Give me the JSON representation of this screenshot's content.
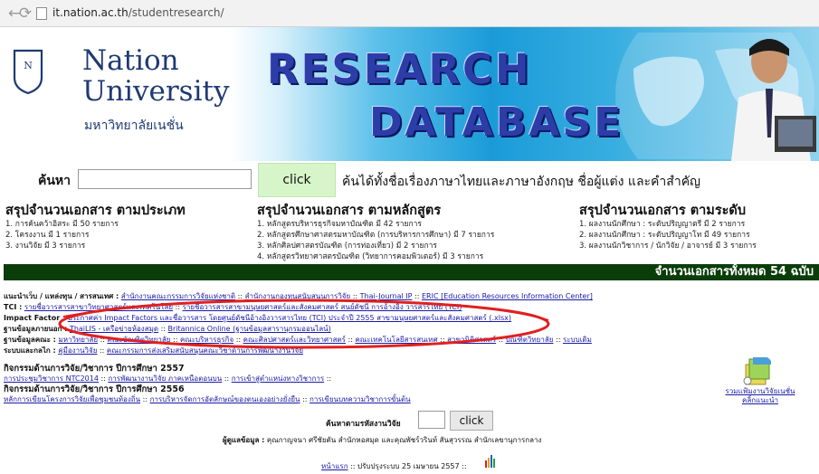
{
  "browser": {
    "url_host": "it.nation.ac.th",
    "url_path": "/studentresearch/"
  },
  "banner": {
    "logo_line1": "Nation",
    "logo_line2": "University",
    "logo_thai": "มหาวิทยาลัยเนชั่น",
    "title_line1": "RESEARCH",
    "title_line2": "DATABASE"
  },
  "search": {
    "label": "ค้นหา",
    "input_value": "",
    "button_label": "click",
    "hint": "ค้นได้ทั้งชื่อเรื่องภาษาไทยและภาษาอังกฤษ ชื่อผู้แต่ง และคำสำคัญ"
  },
  "summary": {
    "by_type": {
      "heading": "สรุปจำนวนเอกสาร ตามประเภท",
      "items": [
        "1. การค้นคว้าอิสระ มี 50 รายการ",
        "2. โครงงาน มี 1 รายการ",
        "3. งานวิจัย มี 3 รายการ"
      ]
    },
    "by_program": {
      "heading": "สรุปจำนวนเอกสาร ตามหลักสูตร",
      "items": [
        "1. หลักสูตรบริหารธุรกิจมหาบัณฑิต มี 42 รายการ",
        "2. หลักสูตรศึกษาศาสตรมหาบัณฑิต (การบริหารการศึกษา) มี 7 รายการ",
        "3. หลักศิลปศาสตรบัณฑิต (การท่องเที่ยว) มี 2 รายการ",
        "4. หลักสูตรวิทยาศาสตรบัณฑิต (วิทยาการคอมพิวเตอร์) มี 3 รายการ"
      ]
    },
    "by_level": {
      "heading": "สรุปจำนวนเอกสาร ตามระดับ",
      "items": [
        "1. ผลงานนักศึกษา : ระดับปริญญาตรี มี 2 รายการ",
        "2. ผลงานนักศึกษา : ระดับปริญญาโท มี 49 รายการ",
        "3. ผลงานนักวิชาการ / นักวิจัย / อาจารย์ มี 3 รายการ"
      ]
    }
  },
  "total_text": "จำนวนเอกสารทั้งหมด 54 ฉบับ",
  "links": {
    "row1_label": "แนะนำเว็บ / แหล่งทุน / สารสนเทศ :",
    "row1_a": "สำนักงานคณะกรรมการวิจัยแห่งชาติ",
    "row1_b": "สำนักงานกองทุนสนับสนุนการวิจัย",
    "row1_c": "Thai-Journal IP",
    "row1_d": "ERIC [Education Resources Information Center]",
    "row2_label": "TCI :",
    "row2_a": "รายชื่อวารสารสาขาวิทยาศาสตร์และเทคโนโลยี",
    "row2_b": "รายชื่อวารสารสาขามนุษยศาสตร์และสังคมศาสตร์ สนย์ดัชนี การอ้างอิง วารสารไทย (TCI)",
    "row3_label": "Impact Factor :",
    "row3_a": "ประกาศค่า Impact Factors และชื่อวารสาร โดยศูนย์ดัชนีอ้างอิงวารสารไทย (TCI) ประจำปี 2555 สาขามนุษยศาสตร์และสังคมศาสตร์ (.xlsx)",
    "row4_label": "ฐานข้อมูลภายนอก :",
    "row4_a": "ThaiLIS - เครือข่ายห้องสมุด",
    "row4_b": "Britannica Online (ฐานข้อมูลสารานุกรมออนไลน์)",
    "row5_label": "ฐานข้อมูลคณะ :",
    "row5_a": "มหาวิทยาลัย",
    "row5_b": "คณะบัณฑิตวิทยาลัย",
    "row5_c": "คณะบริหารธุรกิจ",
    "row5_d": "คณะศิลปศาสตร์และวิทยาศาสตร์",
    "row5_e": "คณะเทคโนโลยีสารสนเทศ",
    "row5_f": "สาขานิติศาสตร์",
    "row5_g": "บัณฑิตวิทยาลัย",
    "row5_h": "ระบบเดิม",
    "row6_label": "ระบบและกลไก :",
    "row6_a": "คู่มืองานวิจัย",
    "row6_b": "คณะกรรมการส่งเสริมสนับสนุนคณะวิชาด้านการพัฒนางานวิจัย"
  },
  "activities_2557": {
    "heading": "กิจกรรมด้านการวิจัย/วิชาการ ปีการศึกษา 2557",
    "a": "การประชุมวิชาการ NTC2014",
    "b": "การพัฒนางานวิจัย ภาคเหนือตอนบน",
    "c": "การเข้าสู่ตำแหน่งทางวิชาการ"
  },
  "activities_2556": {
    "heading": "กิจกรรมด้านการวิจัย/วิชาการ ปีการศึกษา 2556",
    "a": "หลักการเขียนโครงการวิจัยเพื่อชุมชนท้องถิ่น",
    "b": "การบริหารจัดการอัตลักษณ์ของตนเองอย่างยั่งยืน",
    "c": "การเขียนบทความวิชาการขั้นต้น"
  },
  "app_label_line1": "รวมแฟ้มงานวิจัยเนชั่น",
  "app_label_line2": "คลิ้กแนะนำ",
  "code_search": {
    "label": "ค้นหาตามรหัสงานวิจัย",
    "input_value": "",
    "button_label": "click"
  },
  "maintainer": {
    "label": "ผู้ดูแลข้อมูล :",
    "text": "คุณกาญจนา ศรีชัยตัน สำนักหอสมุด และคุณพัชร์วรินท์ สันสุวรรณ สำนักเลขานุการกลาง"
  },
  "footer": {
    "home_link": "หน้าแรก",
    "updated": ":: ปรับปรุงระบบ 25 เมษายน 2557 ::"
  }
}
